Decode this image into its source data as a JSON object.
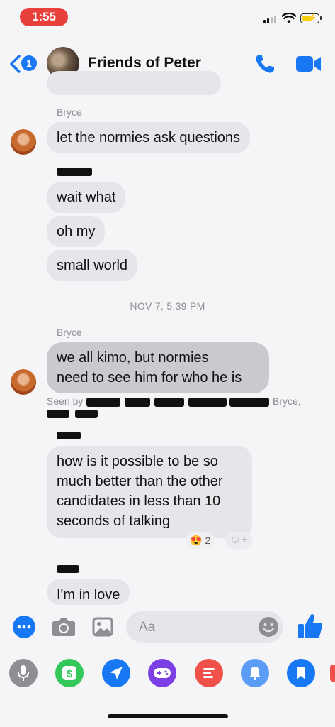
{
  "status_bar": {
    "time": "1:55"
  },
  "header": {
    "unread_count": "1",
    "title": "Friends of Peter"
  },
  "thread": {
    "sender_bryce": "Bryce",
    "msg_bryce_1": "let the normies ask questions",
    "msg_group_1": [
      "wait what",
      "oh my",
      "small world"
    ],
    "timestamp": "NOV 7, 5:39 PM",
    "sender_bryce_2": "Bryce",
    "msg_bryce_2_line1": "we all kimo, but normies",
    "msg_bryce_2_line2": "need to see him for who he is",
    "seen_prefix": "Seen by",
    "seen_name": "Bryce,",
    "msg_long": [
      "how is it possible to be so",
      "much better than the other",
      "candidates in less than 10",
      "seconds of talking"
    ],
    "reaction_emoji": "😍",
    "reaction_count": "2",
    "reaction_add": "☺+",
    "msg_last": "I'm in love"
  },
  "composer": {
    "placeholder": "Aa"
  },
  "apps": [
    "microphone-icon",
    "cash-icon",
    "send-location-icon",
    "games-icon",
    "poll-icon",
    "notification-icon",
    "bookmark-icon"
  ],
  "colors": {
    "accent": "#1877f2",
    "bubble": "#e5e5ea"
  }
}
